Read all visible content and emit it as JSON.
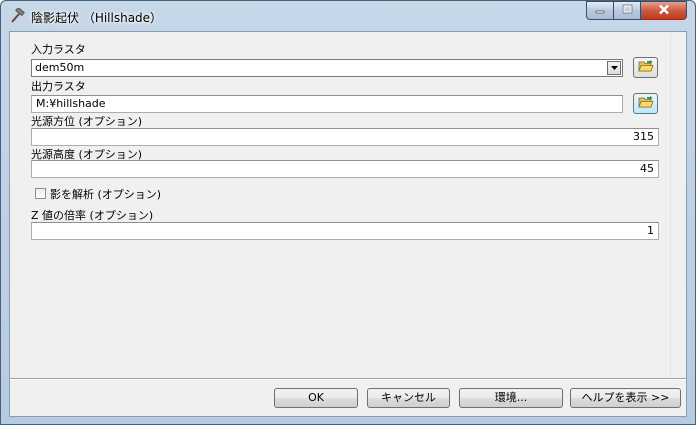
{
  "window": {
    "title": "陰影起伏 （Hillshade）",
    "icon": "hammer-icon"
  },
  "titlebar_buttons": {
    "minimize": "minimize-icon",
    "maximize": "maximize-icon",
    "close": "close-icon"
  },
  "form": {
    "input_raster": {
      "label": "入力ラスタ",
      "value": "dem50m"
    },
    "output_raster": {
      "label": "出力ラスタ",
      "value": "M:¥hillshade"
    },
    "azimuth": {
      "label": "光源方位 (オプション)",
      "value": "315"
    },
    "altitude": {
      "label": "光源高度 (オプション)",
      "value": "45"
    },
    "model_shadows": {
      "label": "影を解析 (オプション)",
      "checked": false
    },
    "z_factor": {
      "label": "Z 値の倍率 (オプション)",
      "value": "1"
    }
  },
  "buttons": {
    "ok": "OK",
    "cancel": "キャンセル",
    "environments": "環境...",
    "help": "ヘルプを表示 >>"
  },
  "colors": {
    "frame": "#c6d7e8",
    "client": "#f0f0f0",
    "close_button": "#c2391c"
  }
}
